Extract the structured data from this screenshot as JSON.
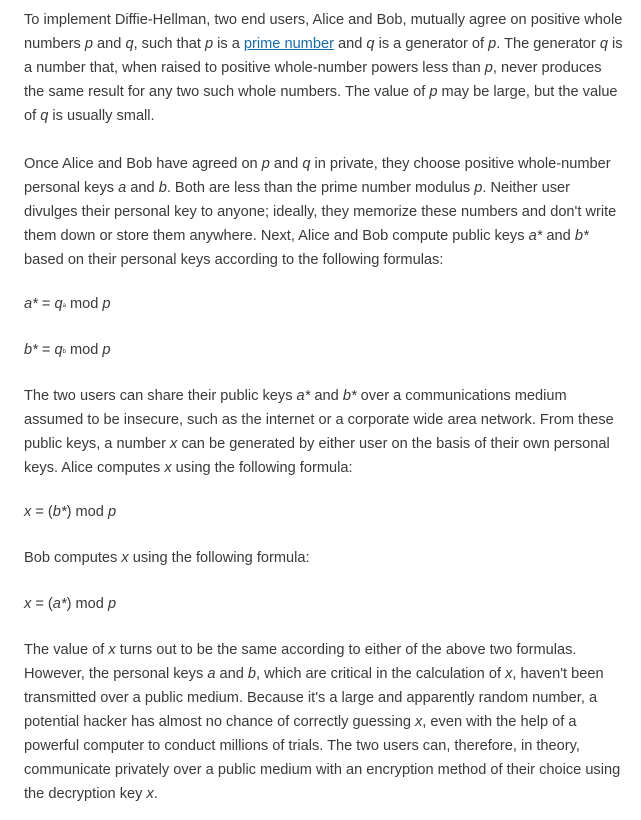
{
  "p1": {
    "s1": "To implement Diffie-Hellman, two end users, Alice and Bob, mutually agree on positive whole numbers ",
    "p": "p",
    "and": " and ",
    "q": "q",
    "s2": ", such that ",
    "s3": " is a ",
    "link": "prime number",
    "s4": " and ",
    "s5": " is a generator of ",
    "s6": ". The generator ",
    "s7": " is a number that, when raised to positive whole-number powers less than ",
    "s8": ", never produces the same result for any two such whole numbers. The value of ",
    "s9": " may be large, but the value of ",
    "s10": " is usually small."
  },
  "p2": {
    "s1": "Once Alice and Bob have agreed on ",
    "s2": " in private, they choose positive whole-number personal keys ",
    "a": "a",
    "b": "b",
    "s3": ". Both are less than the prime number modulus ",
    "s4": ". Neither user divulges their personal key to anyone; ideally, they memorize these numbers and don't write them down or store them anywhere. Next, Alice and Bob compute public keys ",
    "astar": "a*",
    "bstar": "b*",
    "s5": " based on their personal keys according to the following formulas:"
  },
  "f1": {
    "lhs": "a*",
    "eq": " = ",
    "q": "q",
    "exp": "a",
    "mod": " mod ",
    "p": "p"
  },
  "f2": {
    "lhs": "b*",
    "eq": " = ",
    "q": "q",
    "exp": "b",
    "mod": " mod ",
    "p": "p"
  },
  "p3": {
    "s1": "The two users can share their public keys ",
    "s2": " over a communications medium assumed to be insecure, such as the internet or a corporate wide area network. From these public keys, a number ",
    "x": "x",
    "s3": " can be generated by either user on the basis of their own personal keys. Alice computes ",
    "s4": " using the following formula:"
  },
  "f3": {
    "x": "x",
    "eq": " = (",
    "inner": "b*",
    "close": ") mod ",
    "p": "p"
  },
  "p4": {
    "s1": "Bob computes ",
    "s2": " using the following formula:"
  },
  "f4": {
    "x": "x",
    "eq": " = (",
    "inner": "a*",
    "close": ") mod ",
    "p": "p"
  },
  "p5": {
    "s1": "The value of ",
    "s2": " turns out to be the same according to either of the above two formulas. However, the personal keys ",
    "s3": ", which are critical in the calculation of ",
    "s4": ", haven't been transmitted over a public medium. Because it's a large and apparently random number, a potential hacker has almost no chance of correctly guessing ",
    "s5": ", even with the help of a powerful computer to conduct millions of trials. The two users can, therefore, in theory, communicate privately over a public medium with an encryption method of their choice using the decryption key ",
    "s6": "."
  },
  "colors": {
    "text": "#3a3a3a",
    "link": "#1a6aa6",
    "background": "#ffffff"
  }
}
